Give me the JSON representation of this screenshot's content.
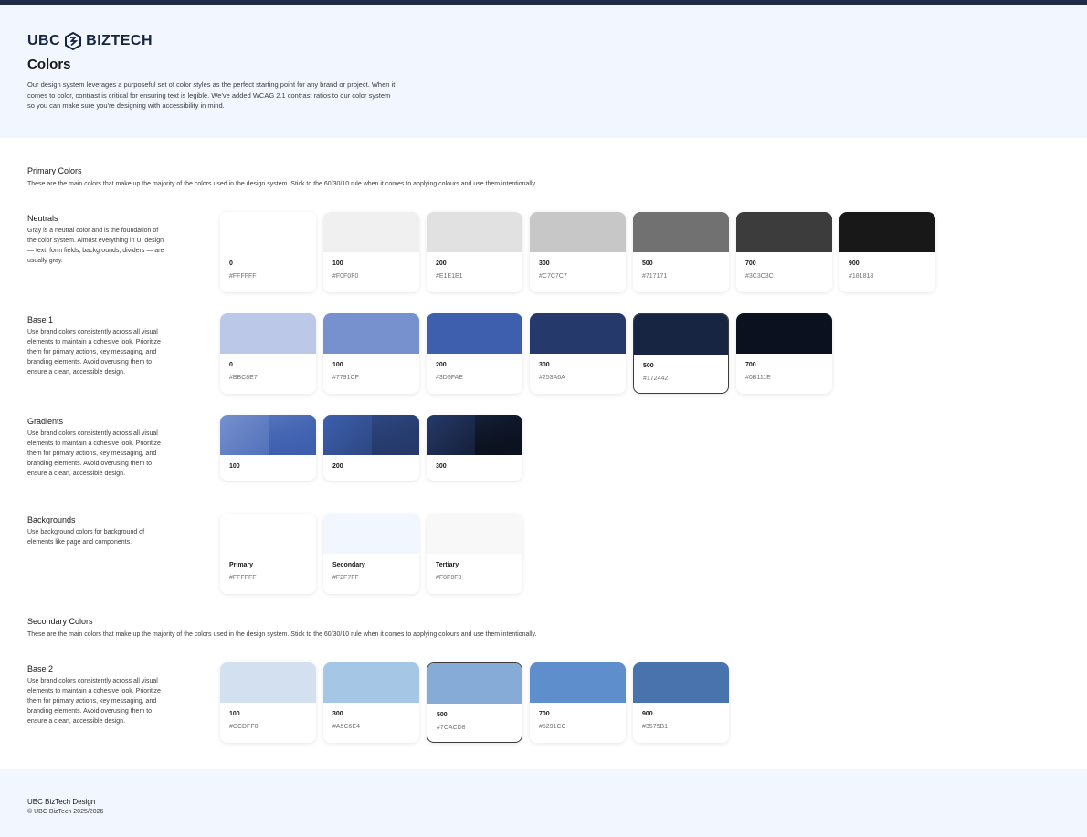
{
  "header": {
    "logo_left": "UBC",
    "logo_right": "BIZTECH",
    "title": "Colors",
    "intro": "Our design system leverages a purposeful set of color styles as the perfect starting point for any brand or project. When it comes to color, contrast is critical for ensuring text is legible. We've added WCAG 2.1 contrast ratios to our color system so you can make sure you're designing with accessibility in mind."
  },
  "primary": {
    "title": "Primary Colors",
    "desc": "These are the main colors that make up the majority of the colors used in the design system. Stick to the 60/30/10 rule when it comes to applying colours and use them intentionally."
  },
  "neutrals": {
    "title": "Neutrals",
    "desc": "Gray is a neutral color and is the foundation of the color system. Almost everything in UI design — text, form fields, backgrounds, dividers — are usually gray.",
    "swatches": [
      {
        "name": "0",
        "hex": "#FFFFFF",
        "color": "#FFFFFF"
      },
      {
        "name": "100",
        "hex": "#F0F0F0",
        "color": "#F0F0F0"
      },
      {
        "name": "200",
        "hex": "#E1E1E1",
        "color": "#E1E1E1"
      },
      {
        "name": "300",
        "hex": "#C7C7C7",
        "color": "#C7C7C7"
      },
      {
        "name": "500",
        "hex": "#717171",
        "color": "#717171"
      },
      {
        "name": "700",
        "hex": "#3C3C3C",
        "color": "#3C3C3C"
      },
      {
        "name": "900",
        "hex": "#181818",
        "color": "#181818"
      }
    ]
  },
  "base1": {
    "title": "Base 1",
    "desc": "Use brand colors consistently across all visual elements to maintain a cohesive look. Prioritize them for primary actions, key messaging, and branding elements. Avoid overusing them to ensure a clean, accessible design.",
    "swatches": [
      {
        "name": "0",
        "hex": "#BBC8E7",
        "color": "#BBC8E7"
      },
      {
        "name": "100",
        "hex": "#7791CF",
        "color": "#7791CF"
      },
      {
        "name": "200",
        "hex": "#3D5FAE",
        "color": "#3D5FAE"
      },
      {
        "name": "300",
        "hex": "#253A6A",
        "color": "#253A6A"
      },
      {
        "name": "500",
        "hex": "#172442",
        "color": "#172442"
      },
      {
        "name": "700",
        "hex": "#0B111E",
        "color": "#0B111E"
      }
    ]
  },
  "gradients": {
    "title": "Gradients",
    "desc": "Use brand colors consistently across all visual elements to maintain a cohesive look. Prioritize them for primary actions, key messaging, and branding elements. Avoid overusing them to ensure a clean, accessible design.",
    "swatches": [
      {
        "name": "100",
        "from": "#7791CF",
        "to": "#3D5FAE"
      },
      {
        "name": "200",
        "from": "#3D5FAE",
        "to": "#253A6A"
      },
      {
        "name": "300",
        "from": "#253A6A",
        "to": "#0B111E"
      }
    ]
  },
  "backgrounds": {
    "title": "Backgrounds",
    "desc": "Use background colors for background of elements like page and components.",
    "swatches": [
      {
        "name": "Primary",
        "hex": "#FFFFFF",
        "color": "#FFFFFF"
      },
      {
        "name": "Secondary",
        "hex": "#F2F7FF",
        "color": "#F2F7FF"
      },
      {
        "name": "Tertiary",
        "hex": "#F8F8F8",
        "color": "#F8F8F8"
      }
    ]
  },
  "secondary": {
    "title": "Secondary Colors",
    "desc": "These are the main colors that make up the majority of the colors used in the design system. Stick to the 60/30/10 rule when it comes to applying colours and use them intentionally."
  },
  "base2": {
    "title": "Base 2",
    "desc": "Use brand colors consistently across all visual elements to maintain a cohesive look. Prioritize them for primary actions, key messaging, and branding elements. Avoid overusing them to ensure a clean, accessible design.",
    "swatches": [
      {
        "name": "100",
        "hex": "#CCDFF0",
        "color": "#D3E0F0"
      },
      {
        "name": "300",
        "hex": "#A5C6E4",
        "color": "#A5C6E4"
      },
      {
        "name": "500",
        "hex": "#7CACD8",
        "color": "#86ABD6"
      },
      {
        "name": "700",
        "hex": "#5291CC",
        "color": "#5E8FCC"
      },
      {
        "name": "900",
        "hex": "#3575B1",
        "color": "#4973AD"
      }
    ]
  },
  "footer": {
    "line1": "UBC BizTech Design",
    "line2": "© UBC BizTech 2025/2026"
  }
}
